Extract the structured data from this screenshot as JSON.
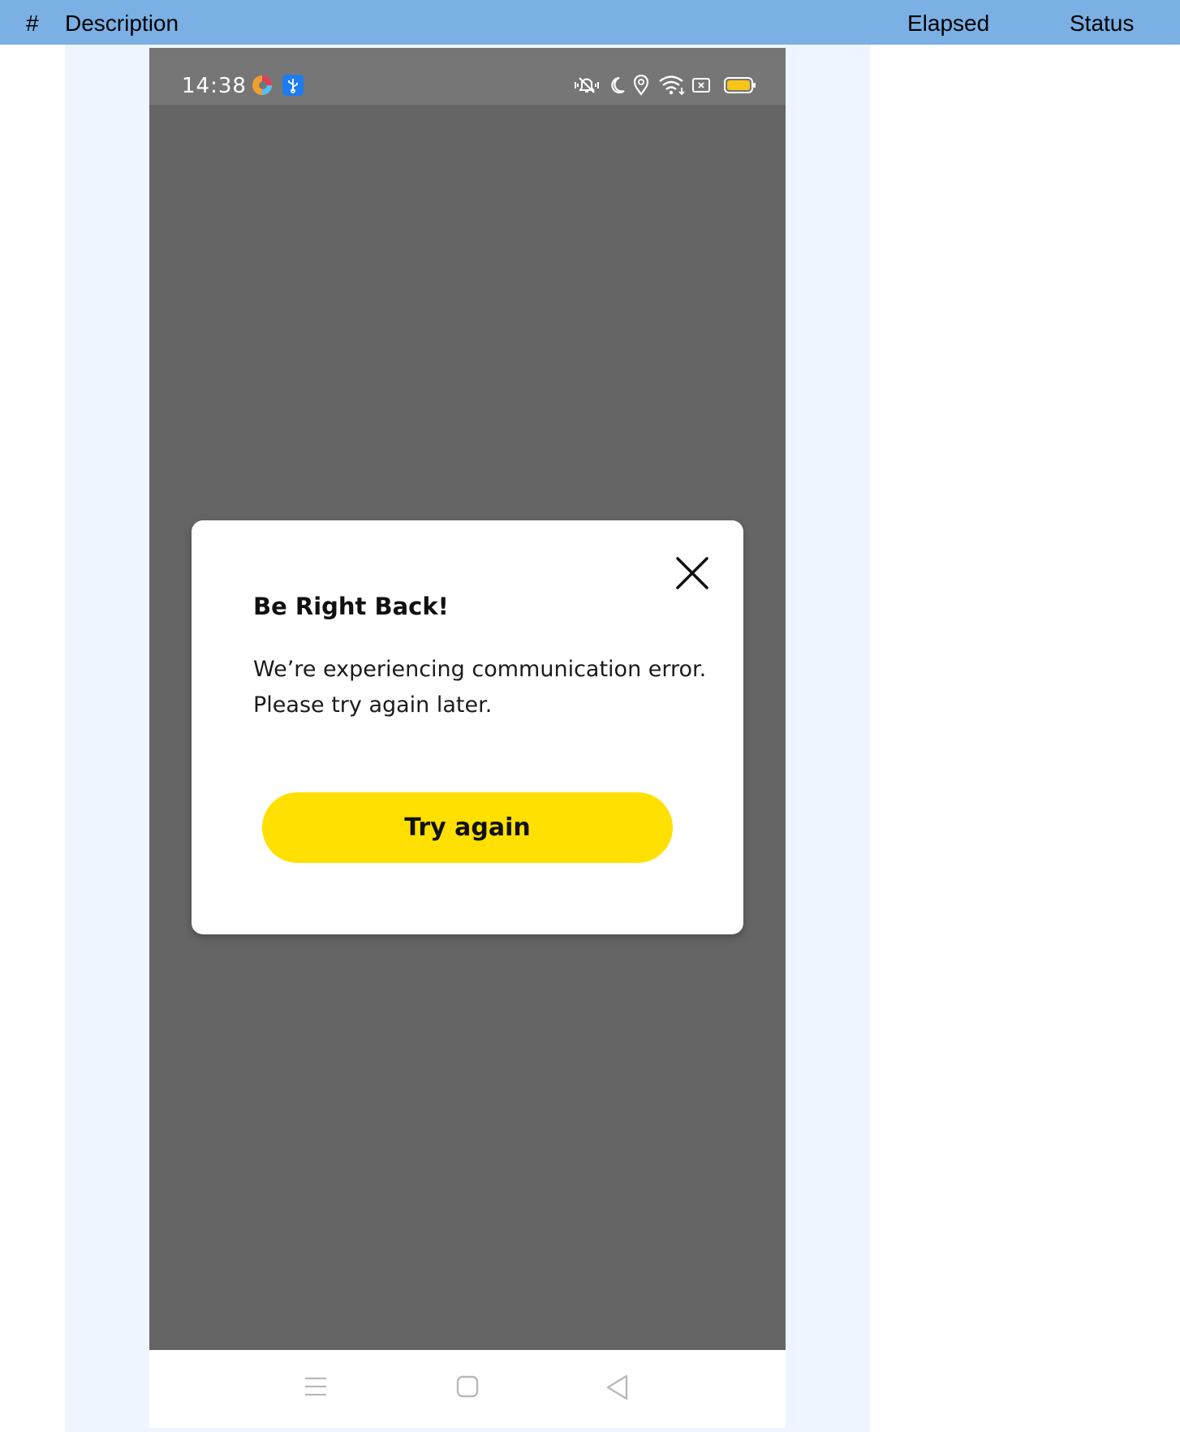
{
  "table_header": {
    "num": "#",
    "description": "Description",
    "elapsed": "Elapsed",
    "status": "Status"
  },
  "phone": {
    "status_bar": {
      "time": "14:38",
      "left_icons": [
        "browser-app-icon",
        "usb-debug-icon"
      ],
      "right_icons": [
        "vibrate-icon",
        "do-not-disturb-moon-icon",
        "location-icon",
        "wifi-icon",
        "screen-cast-icon",
        "battery-icon"
      ],
      "battery_color": "#f5c518"
    },
    "dialog": {
      "title": "Be Right Back!",
      "message": "We’re experiencing communication error. Please try again later.",
      "button_label": "Try again",
      "button_color": "#ffe000"
    },
    "nav_bar": [
      "menu-icon",
      "home-icon",
      "back-icon"
    ]
  },
  "colors": {
    "header_bg": "#7ab0e4",
    "row_bg": "#eef5ff",
    "overlay_bg": "#666566"
  }
}
